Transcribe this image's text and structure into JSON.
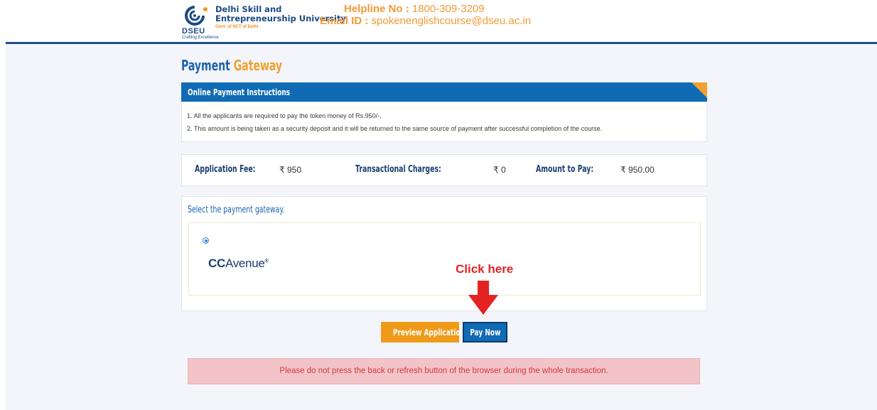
{
  "header": {
    "org_short": "DSEU",
    "org_line1": "Delhi Skill and",
    "org_line2": "Entrepreneurship University",
    "govt": "Govt. of NCT of Delhi",
    "tagline": "Crafting Excellence",
    "helpline_label": "Helpline No :",
    "helpline_value": "1800-309-3209",
    "email_label": "Email ID :",
    "email_value": "spokenenglishcourse@dseu.ac.in"
  },
  "page": {
    "title_part1": "Payment",
    "title_part2": "Gateway"
  },
  "instructions": {
    "heading": "Online Payment Instructions",
    "items": [
      "1. All the applicants are required to pay the token money of Rs.950/-.",
      "2. This amount is being taken as a security deposit and it will be returned to the same source of payment after successful completion of the course."
    ]
  },
  "fees": {
    "application_fee_label": "Application Fee:",
    "application_fee_value": "₹ 950",
    "transactional_label": "Transactional Charges:",
    "transactional_value": "₹ 0",
    "amount_label": "Amount to Pay:",
    "amount_value": "₹ 950.00"
  },
  "gateway": {
    "title": "Select the payment gateway.",
    "option_cc": "CC",
    "option_avenue": "Avenue",
    "option_reg": "®",
    "selected": true
  },
  "annotation": {
    "click_here": "Click here"
  },
  "buttons": {
    "preview": "Preview Application",
    "pay": "Pay Now"
  },
  "warning": "Please do not press the back or refresh button of the browser during the whole transaction.",
  "colors": {
    "brand_blue": "#0f6bb4",
    "brand_orange": "#f09a1a",
    "alert_red": "#e52222"
  }
}
